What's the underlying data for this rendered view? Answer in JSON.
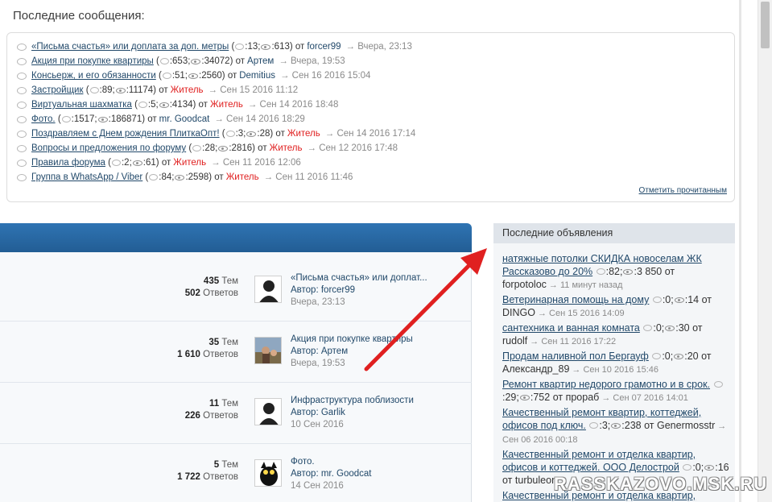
{
  "recent": {
    "title": "Последние сообщения:",
    "mark_read": "Отметить прочитанным",
    "items": [
      {
        "topic": "«Письма счастья» или доплата за доп. метры",
        "replies": ":13;",
        "views": ":613)",
        "by": "от",
        "author": "forcer99",
        "author_red": false,
        "ago": "→ Вчера, 23:13"
      },
      {
        "topic": "Акция при покупке квартиры",
        "replies": ":653;",
        "views": ":34072)",
        "by": "от",
        "author": "Артем",
        "author_red": false,
        "ago": "→ Вчера, 19:53"
      },
      {
        "topic": "Консьерж, и его обязанности",
        "replies": ":51;",
        "views": ":2560)",
        "by": "от",
        "author": "Demitius",
        "author_red": false,
        "ago": "→ Сен 16 2016 15:04"
      },
      {
        "topic": "Застройщик",
        "replies": ":89;",
        "views": ":11174)",
        "by": "от",
        "author": "Житель",
        "author_red": true,
        "ago": "→ Сен 15 2016 11:12"
      },
      {
        "topic": "Виртуальная шахматка",
        "replies": ":5;",
        "views": ":4134)",
        "by": "от",
        "author": "Житель",
        "author_red": true,
        "ago": "→ Сен 14 2016 18:48"
      },
      {
        "topic": "Фото.",
        "replies": ":1517;",
        "views": ":186871)",
        "by": "от",
        "author": "mr. Goodcat",
        "author_red": false,
        "ago": "→ Сен 14 2016 18:29"
      },
      {
        "topic": "Поздравляем с Днем рождения ПлиткаОпт!",
        "replies": ":3;",
        "views": ":28)",
        "by": "от",
        "author": "Житель",
        "author_red": true,
        "ago": "→ Сен 14 2016 17:14"
      },
      {
        "topic": "Вопросы и предложения по форуму",
        "replies": ":28;",
        "views": ":2816)",
        "by": "от",
        "author": "Житель",
        "author_red": true,
        "ago": "→ Сен 12 2016 17:48"
      },
      {
        "topic": "Правила форума",
        "replies": ":2;",
        "views": ":61)",
        "by": "от",
        "author": "Житель",
        "author_red": true,
        "ago": "→ Сен 11 2016 12:06"
      },
      {
        "topic": "Группа в WhatsApp / Viber",
        "replies": ":84;",
        "views": ":2598)",
        "by": "от",
        "author": "Житель",
        "author_red": true,
        "ago": "→ Сен 11 2016 11:46"
      }
    ]
  },
  "forums": [
    {
      "topics_num": "435",
      "topics_label": "Тем",
      "replies_num": "502",
      "replies_label": "Ответов",
      "lp_title": "«Письма счастья» или доплат...",
      "lp_author": "Автор: forcer99",
      "lp_date": "Вчера, 23:13",
      "avatar": "default-avatar-icon"
    },
    {
      "topics_num": "35",
      "topics_label": "Тем",
      "replies_num": "1 610",
      "replies_label": "Ответов",
      "lp_title": "Акция при покупке квартиры",
      "lp_author": "Автор: Артем",
      "lp_date": "Вчера, 19:53",
      "avatar": "photo-avatar"
    },
    {
      "topics_num": "11",
      "topics_label": "Тем",
      "replies_num": "226",
      "replies_label": "Ответов",
      "lp_title": "Инфраструктура поблизости",
      "lp_author": "Автор: Garlik",
      "lp_date": "10 Сен 2016",
      "avatar": "default-avatar-icon"
    },
    {
      "topics_num": "5",
      "topics_label": "Тем",
      "replies_num": "1 722",
      "replies_label": "Ответов",
      "lp_title": "Фото.",
      "lp_author": "Автор: mr. Goodcat",
      "lp_date": "14 Сен 2016",
      "avatar": "cat-avatar"
    }
  ],
  "ads": {
    "title": "Последние объявления",
    "items": [
      {
        "title": "натяжные потолки СКИДКА новоселам ЖК Рассказово до 20%",
        "replies": ":82;",
        "views": ":3 850",
        "by": "от",
        "author": "forpotoloc",
        "ago": "→ 11 минут назад"
      },
      {
        "title": "Ветеринарная помощь на дому",
        "replies": ":0;",
        "views": ":14",
        "by": "от",
        "author": "DINGO",
        "ago": "→ Сен 15 2016 14:09"
      },
      {
        "title": "сантехника и ванная комната",
        "replies": ":0;",
        "views": ":30",
        "by": "от",
        "author": "rudolf",
        "ago": "→ Сен 11 2016 17:22"
      },
      {
        "title": "Продам наливной пол Бергауф",
        "replies": ":0;",
        "views": ":20",
        "by": "от",
        "author": "Александр_89",
        "ago": "→ Сен 10 2016 15:46"
      },
      {
        "title": "Ремонт квартир недорого грамотно и в срок.",
        "replies": ":29;",
        "views": ":752",
        "by": "от",
        "author": "прораб",
        "ago": "→ Сен 07 2016 14:01"
      },
      {
        "title": "Качественный ремонт квартир, коттеджей, офисов под ключ.",
        "replies": ":3;",
        "views": ":238",
        "by": "от",
        "author": "Genermosstr",
        "ago": "→ Сен 06 2016 00:18"
      },
      {
        "title": "Качественный ремонт и отделка квартир, офисов и коттеджей. ООО Делострой",
        "replies": ":0;",
        "views": ":16",
        "by": "от",
        "author": "turbuleon",
        "ago": ""
      },
      {
        "title": "Качественный ремонт и отделка квартир, офисов и коттеджей. ООО Делострой",
        "replies": "",
        "views": "",
        "by": "",
        "author": "",
        "ago": ""
      }
    ]
  },
  "watermark": "RASSKAZOVO.MSK.RU",
  "colors": {
    "link": "#22496a",
    "author_red": "#e02020",
    "header_blue": "#2a6ba6",
    "arrow_red": "#e02020"
  }
}
